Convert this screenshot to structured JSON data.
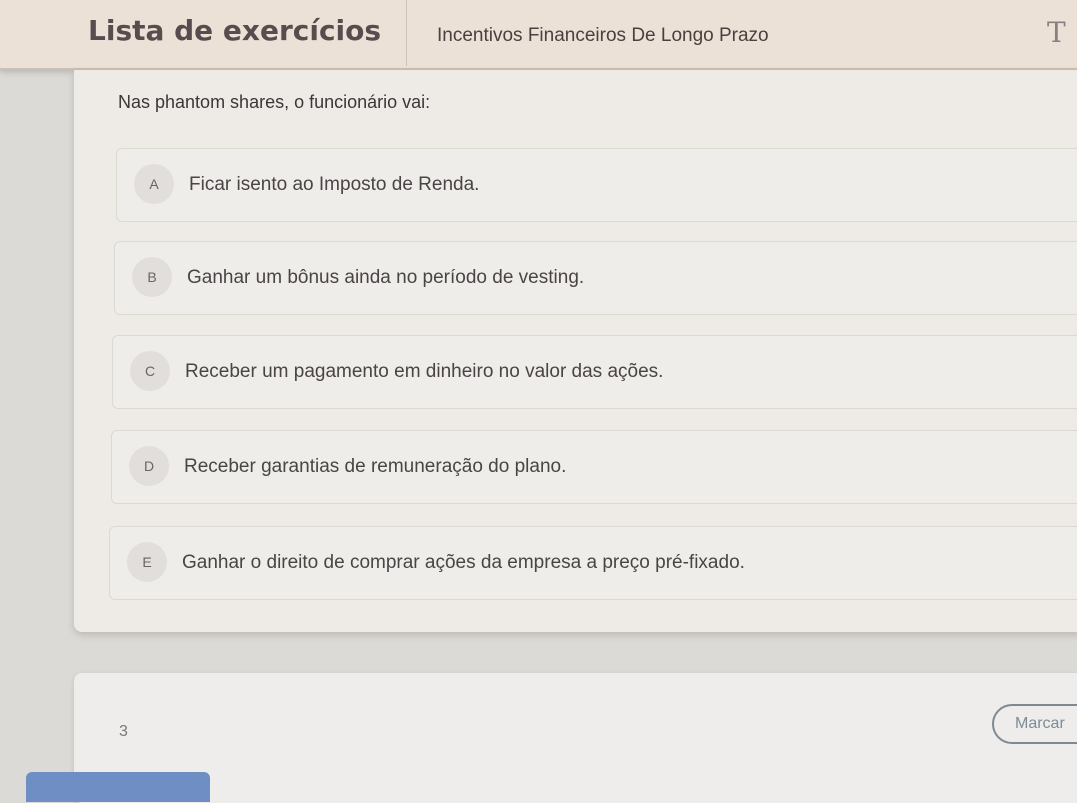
{
  "header": {
    "app_title": "Lista de exercícios",
    "subject": "Incentivos Financeiros De Longo Prazo",
    "font_toggle": "T"
  },
  "question": {
    "text": "Nas phantom shares, o funcionário vai:",
    "options": [
      {
        "letter": "A",
        "text": "Ficar isento ao Imposto de Renda."
      },
      {
        "letter": "B",
        "text": "Ganhar um bônus ainda no período de vesting."
      },
      {
        "letter": "C",
        "text": "Receber um pagamento em dinheiro no valor das ações."
      },
      {
        "letter": "D",
        "text": "Receber garantias de remuneração do plano."
      },
      {
        "letter": "E",
        "text": "Ganhar o direito de comprar ações da empresa a preço pré-fixado."
      }
    ]
  },
  "footer": {
    "page_number": "3",
    "mark_label": "Marcar"
  },
  "colors": {
    "header_bg": "#ece1d6",
    "accent_blue": "#6f8fc4",
    "title_color": "#5a4b4e"
  }
}
